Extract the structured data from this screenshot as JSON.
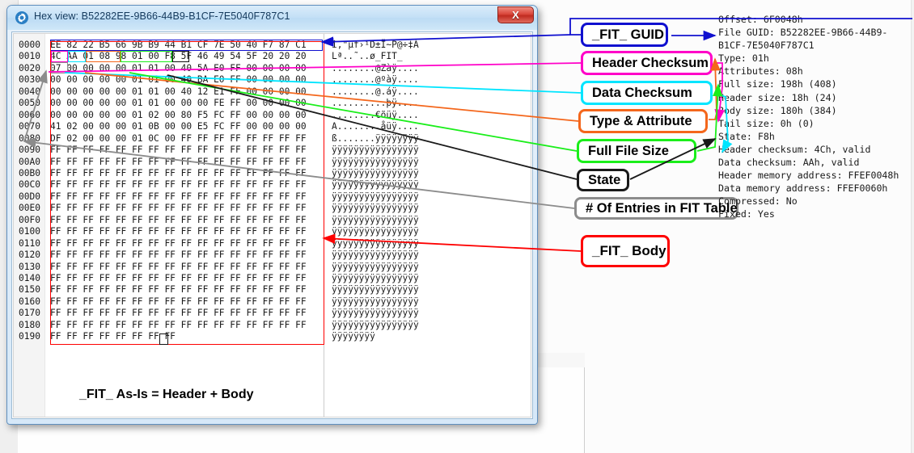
{
  "window": {
    "title": "Hex view: B52282EE-9B66-44B9-B1CF-7E5040F787C1",
    "close_label": "X",
    "icon": "gear-icon"
  },
  "hex": {
    "rows": [
      {
        "offset": "0000",
        "bytes": "EE 82 22 B5 66 9B B9 44 B1 CF 7E 50 40 F7 87 C1",
        "ascii": "î‚\"µf›¹D±Ï~P@÷‡Á"
      },
      {
        "offset": "0010",
        "bytes": "4C AA 01 08 98 01 00 F8 5F 46 49 54 5F 20 20 20",
        "ascii": "Lª..˜..ø_FIT_   "
      },
      {
        "offset": "0020",
        "bytes": "07 00 00 00 00 01 01 00 40 5A E0 FF 00 00 00 00",
        "ascii": "........@Zàÿ...."
      },
      {
        "offset": "0030",
        "bytes": "00 00 00 00 00 01 01 00 40 BA E0 FF 00 00 00 00",
        "ascii": "........@ºàÿ...."
      },
      {
        "offset": "0040",
        "bytes": "00 00 00 00 00 01 01 00 40 12 E1 FF 00 00 00 00",
        "ascii": "........@.áÿ...."
      },
      {
        "offset": "0050",
        "bytes": "00 00 00 00 00 01 01 00 00 00 FE FF 00 00 00 00",
        "ascii": "..........þÿ...."
      },
      {
        "offset": "0060",
        "bytes": "00 00 00 00 00 01 02 00 80 F5 FC FF 00 00 00 00",
        "ascii": "........€õüÿ...."
      },
      {
        "offset": "0070",
        "bytes": "41 02 00 00 00 01 0B 00 00 E5 FC FF 00 00 00 00",
        "ascii": "A........åüÿ...."
      },
      {
        "offset": "0080",
        "bytes": "DF 02 00 00 00 01 0C 00 FF FF FF FF FF FF FF FF",
        "ascii": "ß.......ÿÿÿÿÿÿÿÿ"
      },
      {
        "offset": "0090",
        "bytes": "FF FF FF FF FF FF FF FF FF FF FF FF FF FF FF FF",
        "ascii": "ÿÿÿÿÿÿÿÿÿÿÿÿÿÿÿÿ"
      },
      {
        "offset": "00A0",
        "bytes": "FF FF FF FF FF FF FF FF FF FF FF FF FF FF FF FF",
        "ascii": "ÿÿÿÿÿÿÿÿÿÿÿÿÿÿÿÿ"
      },
      {
        "offset": "00B0",
        "bytes": "FF FF FF FF FF FF FF FF FF FF FF FF FF FF FF FF",
        "ascii": "ÿÿÿÿÿÿÿÿÿÿÿÿÿÿÿÿ"
      },
      {
        "offset": "00C0",
        "bytes": "FF FF FF FF FF FF FF FF FF FF FF FF FF FF FF FF",
        "ascii": "ÿÿÿÿÿÿÿÿÿÿÿÿÿÿÿÿ"
      },
      {
        "offset": "00D0",
        "bytes": "FF FF FF FF FF FF FF FF FF FF FF FF FF FF FF FF",
        "ascii": "ÿÿÿÿÿÿÿÿÿÿÿÿÿÿÿÿ"
      },
      {
        "offset": "00E0",
        "bytes": "FF FF FF FF FF FF FF FF FF FF FF FF FF FF FF FF",
        "ascii": "ÿÿÿÿÿÿÿÿÿÿÿÿÿÿÿÿ"
      },
      {
        "offset": "00F0",
        "bytes": "FF FF FF FF FF FF FF FF FF FF FF FF FF FF FF FF",
        "ascii": "ÿÿÿÿÿÿÿÿÿÿÿÿÿÿÿÿ"
      },
      {
        "offset": "0100",
        "bytes": "FF FF FF FF FF FF FF FF FF FF FF FF FF FF FF FF",
        "ascii": "ÿÿÿÿÿÿÿÿÿÿÿÿÿÿÿÿ"
      },
      {
        "offset": "0110",
        "bytes": "FF FF FF FF FF FF FF FF FF FF FF FF FF FF FF FF",
        "ascii": "ÿÿÿÿÿÿÿÿÿÿÿÿÿÿÿÿ"
      },
      {
        "offset": "0120",
        "bytes": "FF FF FF FF FF FF FF FF FF FF FF FF FF FF FF FF",
        "ascii": "ÿÿÿÿÿÿÿÿÿÿÿÿÿÿÿÿ"
      },
      {
        "offset": "0130",
        "bytes": "FF FF FF FF FF FF FF FF FF FF FF FF FF FF FF FF",
        "ascii": "ÿÿÿÿÿÿÿÿÿÿÿÿÿÿÿÿ"
      },
      {
        "offset": "0140",
        "bytes": "FF FF FF FF FF FF FF FF FF FF FF FF FF FF FF FF",
        "ascii": "ÿÿÿÿÿÿÿÿÿÿÿÿÿÿÿÿ"
      },
      {
        "offset": "0150",
        "bytes": "FF FF FF FF FF FF FF FF FF FF FF FF FF FF FF FF",
        "ascii": "ÿÿÿÿÿÿÿÿÿÿÿÿÿÿÿÿ"
      },
      {
        "offset": "0160",
        "bytes": "FF FF FF FF FF FF FF FF FF FF FF FF FF FF FF FF",
        "ascii": "ÿÿÿÿÿÿÿÿÿÿÿÿÿÿÿÿ"
      },
      {
        "offset": "0170",
        "bytes": "FF FF FF FF FF FF FF FF FF FF FF FF FF FF FF FF",
        "ascii": "ÿÿÿÿÿÿÿÿÿÿÿÿÿÿÿÿ"
      },
      {
        "offset": "0180",
        "bytes": "FF FF FF FF FF FF FF FF FF FF FF FF FF FF FF FF",
        "ascii": "ÿÿÿÿÿÿÿÿÿÿÿÿÿÿÿÿ"
      },
      {
        "offset": "0190",
        "bytes": "FF FF FF FF FF FF FF FF",
        "ascii": "ÿÿÿÿÿÿÿÿ"
      }
    ]
  },
  "caption": "_FIT_ As-Is = Header + Body",
  "callouts": [
    {
      "label": "_FIT_ GUID",
      "color": "#1010cf"
    },
    {
      "label": "Header Checksum",
      "color": "#ff00c8"
    },
    {
      "label": "Data Checksum",
      "color": "#00e5ff"
    },
    {
      "label": "Type & Attribute",
      "color": "#f4661b"
    },
    {
      "label": "Full File Size",
      "color": "#1aee1a"
    },
    {
      "label": "State",
      "color": "#1a1a1a"
    },
    {
      "label": "# Of Entries in FIT Table",
      "color": "#8c8c8c"
    },
    {
      "label": "_FIT_ Body",
      "color": "#fe0000"
    }
  ],
  "info": {
    "lines": [
      "Offset: 6F0048h",
      "File GUID: B52282EE-9B66-44B9-",
      "B1CF-7E5040F787C1",
      "Type: 01h",
      "Attributes: 08h",
      "Full size: 198h (408)",
      "Header size: 18h (24)",
      "Body size: 180h (384)",
      "Tail size: 0h (0)",
      "State: F8h",
      "Header checksum: 4Ch, valid",
      "Data checksum: AAh, valid",
      "Header memory address: FFEF0048h",
      "Data memory address: FFEF0060h",
      "Compressed: No",
      "Fixed: Yes"
    ]
  },
  "colors": {
    "guid_blue": "#1010cf",
    "header_checksum_magenta": "#ff00c8",
    "data_checksum_cyan": "#00e5ff",
    "type_attribute_orange": "#f4661b",
    "full_size_green": "#1aee1a",
    "state_black": "#1a1a1a",
    "entries_gray": "#8c8c8c",
    "body_red": "#fe0000"
  }
}
